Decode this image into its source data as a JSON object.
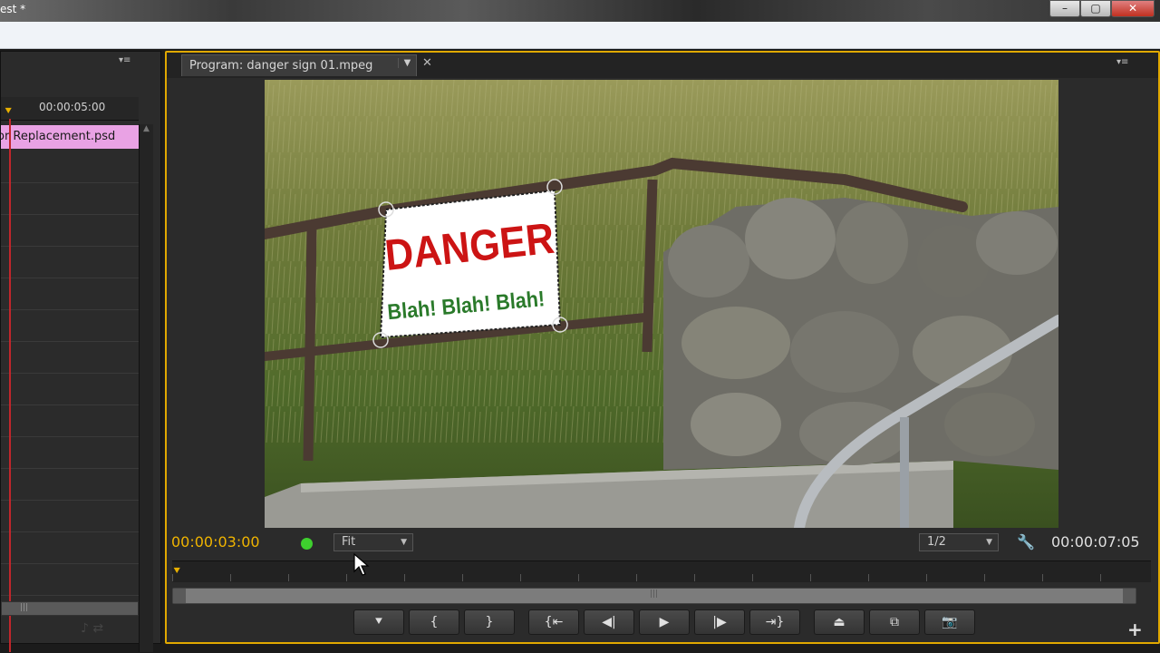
{
  "window": {
    "title": "est *",
    "min_glyph": "–",
    "max_glyph": "▢",
    "close_glyph": "✕"
  },
  "timeline": {
    "menu_glyph": "▾≡",
    "timecode": "00:00:05:00",
    "clip_label": "or Replacement.psd",
    "clip_color": "#e9a2e4",
    "playhead_color": "#c2262b"
  },
  "program_monitor": {
    "tab_label": "Program: danger sign 01.mpeg",
    "tab_dropdown_glyph": "▼",
    "tab_close_glyph": "✕",
    "menu_glyph": "▾≡",
    "sign": {
      "headline": "DANGER",
      "subline": "Blah! Blah! Blah!",
      "headline_color": "#cc1414",
      "subline_color": "#2a7a2a"
    },
    "current_timecode": "00:00:03:00",
    "current_timecode_color": "#f0b400",
    "zoom_select": "Fit",
    "resolution_select": "1/2",
    "duration_timecode": "00:00:07:05",
    "status_dot_color": "#3ecf2e",
    "accent_color": "#e0a800",
    "transport": [
      {
        "name": "add-marker-button",
        "glyph": "⯆",
        "icon": "marker-icon"
      },
      {
        "name": "mark-in-button",
        "glyph": "{",
        "icon": "mark-in-icon"
      },
      {
        "name": "mark-out-button",
        "glyph": "}",
        "icon": "mark-out-icon"
      },
      {
        "name": "go-to-in-button",
        "glyph": "{⇤",
        "icon": "go-to-in-icon"
      },
      {
        "name": "step-back-button",
        "glyph": "◀|",
        "icon": "step-back-icon"
      },
      {
        "name": "play-button",
        "glyph": "▶",
        "icon": "play-icon"
      },
      {
        "name": "step-forward-button",
        "glyph": "|▶",
        "icon": "step-forward-icon"
      },
      {
        "name": "go-to-out-button",
        "glyph": "⇥}",
        "icon": "go-to-out-icon"
      },
      {
        "name": "lift-button",
        "glyph": "⏏",
        "icon": "lift-icon"
      },
      {
        "name": "extract-button",
        "glyph": "⧉",
        "icon": "extract-icon"
      },
      {
        "name": "export-frame-button",
        "glyph": "📷",
        "icon": "camera-icon"
      }
    ],
    "plus_glyph": "+"
  }
}
